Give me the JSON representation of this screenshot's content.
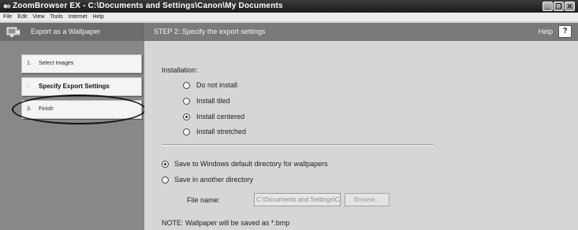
{
  "titlebar": {
    "title": "ZoomBrowser EX  -  C:\\Documents and Settings\\Canon\\My Documents",
    "minimize": "_",
    "restore": "❐",
    "close": "✕"
  },
  "menu": {
    "items": [
      "File",
      "Edit",
      "View",
      "Tools",
      "Internet",
      "Help"
    ]
  },
  "sidebar": {
    "title": "Export as a Wallpaper",
    "steps": [
      {
        "num": "1.",
        "label": "Select Images"
      },
      {
        "num": "2.",
        "label": "Specify Export Settings"
      },
      {
        "num": "3.",
        "label": "Finish"
      }
    ]
  },
  "step_header": {
    "title": "STEP 2: Specify the export settings",
    "help_label": "Help",
    "help_button": "?"
  },
  "installation": {
    "heading": "Installation:",
    "options": [
      "Do not install",
      "Install tiled",
      "Install centered",
      "Install stretched"
    ],
    "selected": "Install centered"
  },
  "save_location": {
    "options": [
      "Save to Windows default directory for wallpapers",
      "Save in another directory"
    ],
    "selected": "Save to Windows default directory for wallpapers"
  },
  "file_name": {
    "label": "File name:",
    "value": "C:\\Documents and Settings\\Canon\\A",
    "browse_label": "Browse..."
  },
  "note": "NOTE: Wallpaper will be saved as *.bmp"
}
